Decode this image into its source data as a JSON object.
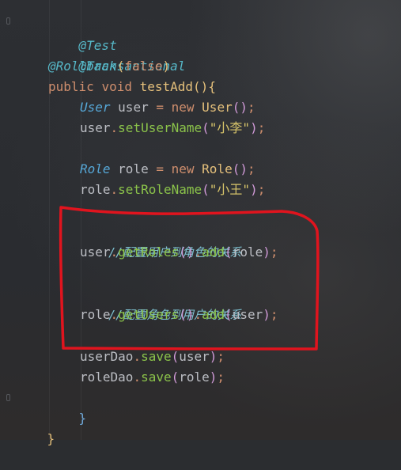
{
  "lines": [
    {
      "text_a": "@Test"
    },
    {
      "text_a": "@Transactional"
    },
    {
      "text_a": "@Rollback",
      "paren_open": "(",
      "value": "false",
      "paren_close": ")"
    },
    {
      "kw1": "public",
      "kw2": "void",
      "method": "testAdd",
      "parens": "()",
      "brace": "{"
    },
    {
      "type": "User",
      "var": "user",
      "eq": "=",
      "new_kw": "new",
      "ctor": "User",
      "parens": "()",
      "semi": ";"
    },
    {
      "obj": "user",
      "dot": ".",
      "call": "setUserName",
      "p_open": "(",
      "str": "\"小李\"",
      "p_close": ")",
      "semi": ";"
    },
    {
      "type": "Role",
      "var": "role",
      "eq": "=",
      "new_kw": "new",
      "ctor": "Role",
      "parens": "()",
      "semi": ";"
    },
    {
      "obj": "role",
      "dot": ".",
      "call": "setRoleName",
      "p_open": "(",
      "str": "\"小王\"",
      "p_close": ")",
      "semi": ";"
    },
    {
      "comment": "//配置用户到角色的关系"
    },
    {
      "obj": "user",
      "dot": ".",
      "call": "getRoles",
      "parens": "()",
      "dot2": ".",
      "call2": "add",
      "p_open": "(",
      "arg": "role",
      "p_close": ")",
      "semi": ";"
    },
    {
      "comment": "//配置角色到用户的关系"
    },
    {
      "obj": "role",
      "dot": ".",
      "call": "getUsers",
      "parens": "()",
      "dot2": ".",
      "call2": "add",
      "p_open": "(",
      "arg": "user",
      "p_close": ")",
      "semi": ";"
    },
    {
      "obj": "userDao",
      "dot": ".",
      "call": "save",
      "p_open": "(",
      "arg": "user",
      "p_close": ")",
      "semi": ";"
    },
    {
      "obj": "roleDao",
      "dot": ".",
      "call": "save",
      "p_open": "(",
      "arg": "role",
      "p_close": ")",
      "semi": ";"
    },
    {
      "brace": "}"
    },
    {
      "brace": "}"
    }
  ],
  "colors": {
    "background": "#2b2d30",
    "annotation": "#56b8c8",
    "keyword": "#cf8e6d",
    "type": "#6fa8d8",
    "method": "#8bc34a",
    "string": "#d7c46a",
    "comment": "#7ec0d0",
    "highlight_box": "#e0141e"
  }
}
